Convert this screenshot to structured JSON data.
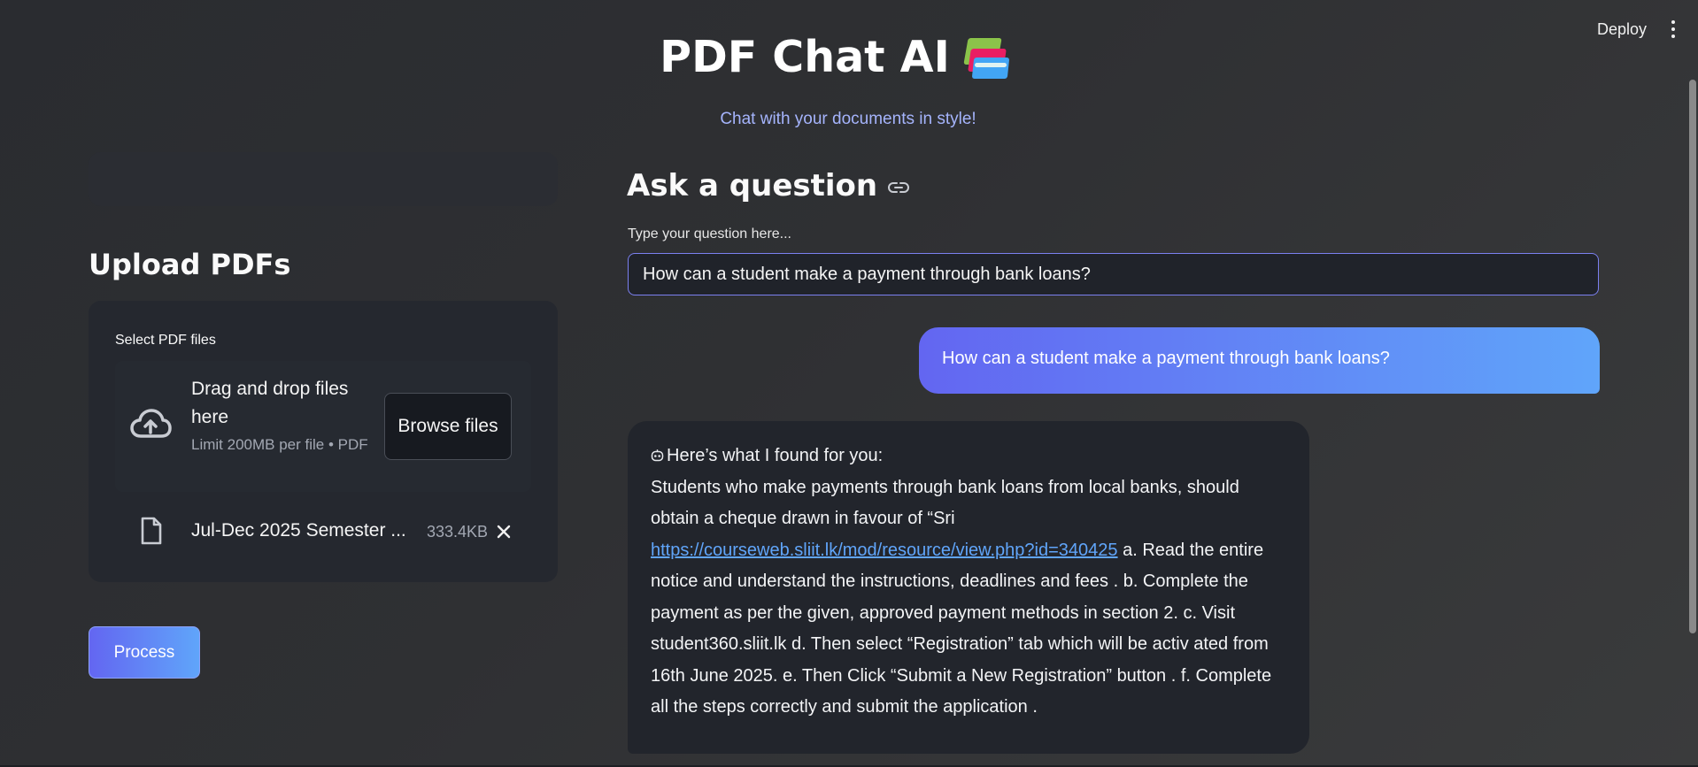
{
  "topbar": {
    "deploy_label": "Deploy",
    "menu_icon": "kebab-menu-icon"
  },
  "header": {
    "title": "PDF Chat AI",
    "title_icon": "books-icon",
    "subtitle": "Chat with your documents in style!"
  },
  "sidebar": {
    "upload_heading": "Upload PDFs",
    "uploader": {
      "label": "Select PDF files",
      "drop_title": "Drag and drop files here",
      "limit_text": "Limit 200MB per file • PDF",
      "browse_label": "Browse files",
      "file": {
        "name": "Jul-Dec 2025 Semester ...",
        "size": "333.4KB"
      }
    },
    "process_label": "Process"
  },
  "main": {
    "ask_heading": "Ask a question",
    "input_label": "Type your question here...",
    "input_value": "How can a student make a payment through bank loans?",
    "messages": {
      "user": "How can a student make a payment through bank loans?",
      "bot": {
        "intro": "Here’s what I found for you:",
        "text_before_link": "Students who make payments through bank loans from local banks, should obtain a cheque drawn in favour of “Sri",
        "link": "https://courseweb.sliit.lk/mod/resource/view.php?id=340425",
        "text_after_link": "a. Read the entire notice and understand the instructions, deadlines and fees . b. Complete the payment as per the given, approved payment methods in section 2. c. Visit student360.sliit.lk d. Then select “Registration” tab which will be activ ated from 16th June 2025. e. Then Click “Submit a New Registration” button . f. Complete all the steps correctly and submit the application ."
      }
    }
  },
  "colors": {
    "accent_start": "#6366f1",
    "accent_end": "#60a5fa",
    "subtitle": "#a5b4fc",
    "link": "#60a5fa"
  }
}
